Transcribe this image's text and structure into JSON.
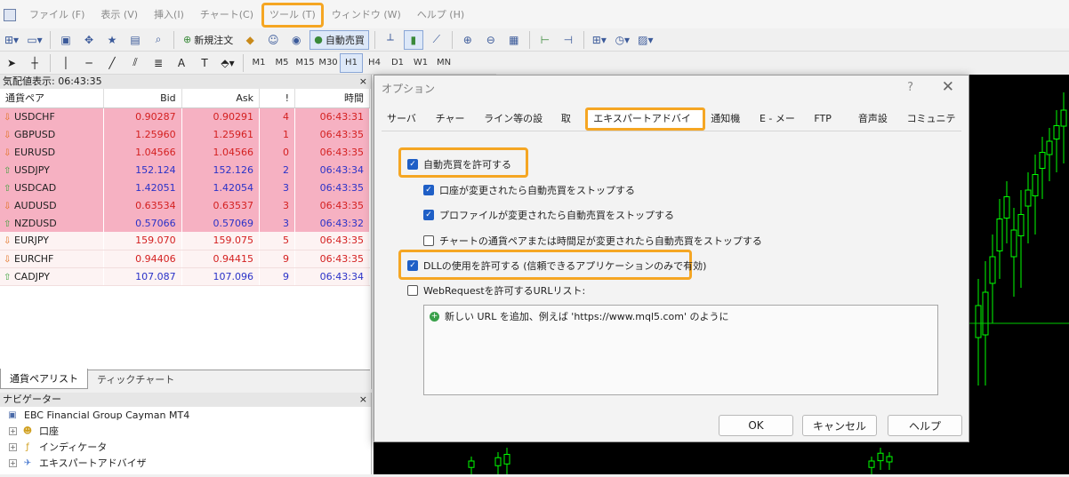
{
  "menu": [
    "ファイル (F)",
    "表示 (V)",
    "挿入(I)",
    "チャート(C)",
    "ツール (T)",
    "ウィンドウ (W)",
    "ヘルプ (H)"
  ],
  "toolbar": {
    "new_order": "新規注文",
    "autotrade": "自動売買"
  },
  "timeframes": [
    "M1",
    "M5",
    "M15",
    "M30",
    "H1",
    "H4",
    "D1",
    "W1",
    "MN"
  ],
  "market_watch": {
    "title": "気配値表示: 06:43:35",
    "close": "×",
    "columns": [
      "通貨ペア",
      "Bid",
      "Ask",
      "!",
      "時間"
    ],
    "rows": [
      {
        "symbol": "USDCHF",
        "bid": "0.90287",
        "ask": "0.90291",
        "spread": "4",
        "time": "06:43:31",
        "dir": "down",
        "style": "pink",
        "color": "red"
      },
      {
        "symbol": "GBPUSD",
        "bid": "1.25960",
        "ask": "1.25961",
        "spread": "1",
        "time": "06:43:35",
        "dir": "down",
        "style": "pink",
        "color": "red"
      },
      {
        "symbol": "EURUSD",
        "bid": "1.04566",
        "ask": "1.04566",
        "spread": "0",
        "time": "06:43:35",
        "dir": "down",
        "style": "pink",
        "color": "red"
      },
      {
        "symbol": "USDJPY",
        "bid": "152.124",
        "ask": "152.126",
        "spread": "2",
        "time": "06:43:34",
        "dir": "up",
        "style": "pink",
        "color": "blue"
      },
      {
        "symbol": "USDCAD",
        "bid": "1.42051",
        "ask": "1.42054",
        "spread": "3",
        "time": "06:43:35",
        "dir": "up",
        "style": "pink",
        "color": "blue"
      },
      {
        "symbol": "AUDUSD",
        "bid": "0.63534",
        "ask": "0.63537",
        "spread": "3",
        "time": "06:43:35",
        "dir": "down",
        "style": "pink",
        "color": "red"
      },
      {
        "symbol": "NZDUSD",
        "bid": "0.57066",
        "ask": "0.57069",
        "spread": "3",
        "time": "06:43:32",
        "dir": "up",
        "style": "pink",
        "color": "blue"
      },
      {
        "symbol": "EURJPY",
        "bid": "159.070",
        "ask": "159.075",
        "spread": "5",
        "time": "06:43:35",
        "dir": "down",
        "style": "light",
        "color": "red"
      },
      {
        "symbol": "EURCHF",
        "bid": "0.94406",
        "ask": "0.94415",
        "spread": "9",
        "time": "06:43:35",
        "dir": "down",
        "style": "light",
        "color": "red"
      },
      {
        "symbol": "CADJPY",
        "bid": "107.087",
        "ask": "107.096",
        "spread": "9",
        "time": "06:43:34",
        "dir": "up",
        "style": "light",
        "color": "blue"
      }
    ],
    "tabs": [
      "通貨ペアリスト",
      "ティックチャート"
    ]
  },
  "navigator": {
    "title": "ナビゲーター",
    "close": "×",
    "items": [
      "EBC Financial Group Cayman MT4",
      "口座",
      "インディケータ",
      "エキスパートアドバイザ"
    ]
  },
  "dialog": {
    "title": "オプション",
    "help": "?",
    "close": "✕",
    "tabs": [
      "サーバー",
      "チャート",
      "ライン等の設定",
      "取引",
      "エキスパートアドバイザ",
      "通知機能",
      "E - メール",
      "FTP",
      "音声設定",
      "コミュニティ"
    ],
    "options": {
      "allow_autotrade": "自動売買を許可する",
      "stop_on_account": "口座が変更されたら自動売買をストップする",
      "stop_on_profile": "プロファイルが変更されたら自動売買をストップする",
      "stop_on_chart": "チャートの通貨ペアまたは時間足が変更されたら自動売買をストップする",
      "allow_dll": "DLLの使用を許可する (信頼できるアプリケーションのみで有効)",
      "webrequest": "WebRequestを許可するURLリスト:"
    },
    "url_add": "新しい URL を追加、例えば 'https://www.mql5.com' のように",
    "ok": "OK",
    "cancel": "キャンセル",
    "helpbtn": "ヘルプ"
  },
  "colors": {
    "accent_highlight": "#f5a623",
    "row_pink": "#f6b1c2",
    "bid_red": "#d42020",
    "bid_blue": "#2a32c8",
    "candle_green": "#00ff00"
  }
}
